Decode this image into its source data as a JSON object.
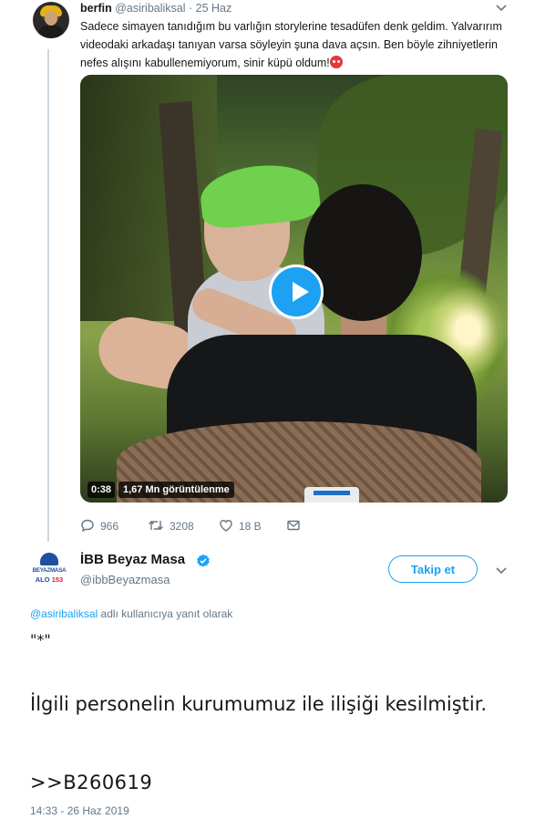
{
  "quoted_tweet": {
    "author_name": "berfin",
    "author_handle": "@asiribaliksal",
    "date": "25 Haz",
    "text": "Sadece simayen tanıdığım bu varlığın storylerine tesadüfen denk geldim. Yalvarırım videodaki arkadaşı tanıyan varsa söyleyin şuna dava açsın. Ben böyle zihniyetlerin nefes alışını kabullenemiyorum, sinir küpü oldum!",
    "emoji_icon": "angry-face-icon",
    "video": {
      "duration": "0:38",
      "views": "1,67 Mn görüntülenme"
    },
    "actions": {
      "replies": "966",
      "retweets": "3208",
      "likes": "18 B"
    }
  },
  "main_tweet": {
    "author_name": "İBB Beyaz Masa",
    "author_handle": "@ibbBeyazmasa",
    "avatar_text": "BEYAZMASA",
    "avatar_alo": "ALO",
    "avatar_alo_number": "153",
    "follow_label": "Takip et",
    "reply_to_handle": "@asiribaliksal",
    "reply_to_suffix": " adlı kullanıcıya yanıt olarak",
    "line1": "\"*\"",
    "line2": "İlgili personelin kurumumuz ile ilişiği kesilmiştir.",
    "line3": ">>B260619",
    "timestamp": "14:33 - 26 Haz 2019"
  },
  "colors": {
    "accent": "#1da1f2",
    "muted_text": "#657786",
    "thread_line": "#ccd6dd"
  }
}
